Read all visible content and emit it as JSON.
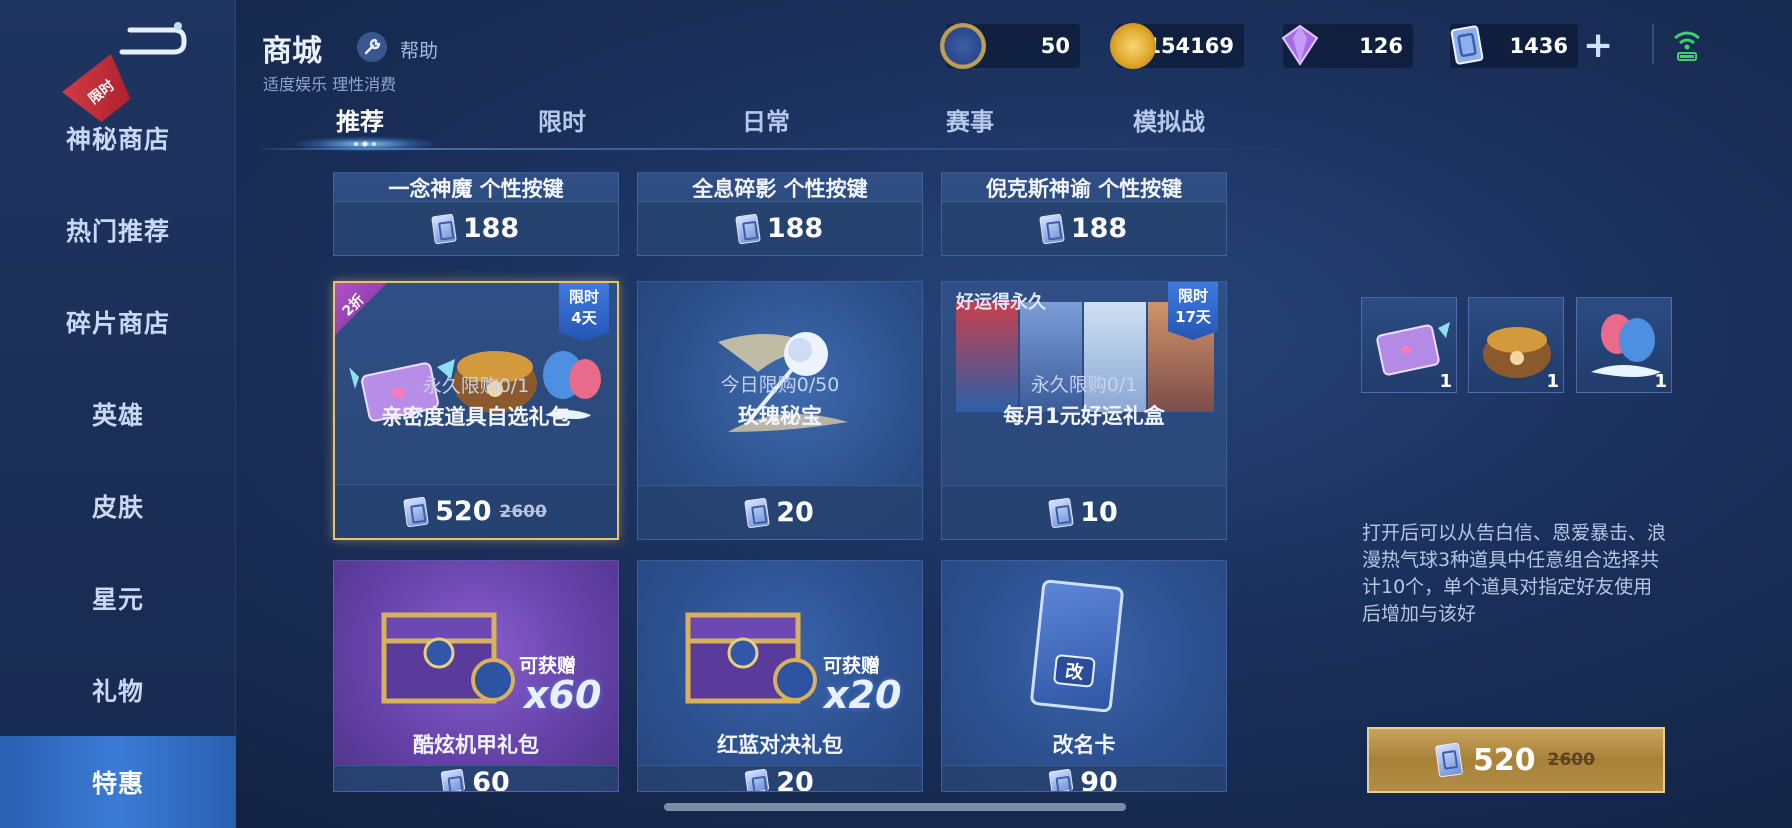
{
  "header": {
    "title": "商城",
    "help_label": "帮助",
    "subtitle": "适度娱乐 理性消费"
  },
  "currencies": [
    {
      "name": "ticket",
      "icon": "ticket-coin-icon",
      "value": "50"
    },
    {
      "name": "gold",
      "icon": "gold-coin-icon",
      "value": "154169"
    },
    {
      "name": "diamond",
      "icon": "diamond-icon",
      "value": "126"
    },
    {
      "name": "coupon",
      "icon": "coupon-icon",
      "value": "1436"
    }
  ],
  "sidebar": {
    "items": [
      {
        "label": "神秘商店",
        "badge": "限时"
      },
      {
        "label": "热门推荐"
      },
      {
        "label": "碎片商店"
      },
      {
        "label": "英雄"
      },
      {
        "label": "皮肤"
      },
      {
        "label": "星元"
      },
      {
        "label": "礼物"
      },
      {
        "label": "特惠",
        "active": true
      }
    ]
  },
  "tabs": [
    "推荐",
    "限时",
    "日常",
    "赛事",
    "模拟战"
  ],
  "active_tab": "推荐",
  "cards": [
    {
      "name": "一念神魔 个性按键",
      "price": "188"
    },
    {
      "name": "全息碎影 个性按键",
      "price": "188"
    },
    {
      "name": "倪克斯神谕 个性按键",
      "price": "188"
    },
    {
      "name": "亲密度道具自选礼包",
      "limit": "永久限购0/1",
      "price": "520",
      "old_price": "2600",
      "discount": "2折",
      "tag_line1": "限时",
      "tag_line2": "4天"
    },
    {
      "name": "玫瑰秘宝",
      "limit": "今日限购0/50",
      "price": "20"
    },
    {
      "name": "每月1元好运礼盒",
      "limit": "永久限购0/1",
      "price": "10",
      "overlay": "好运得永久",
      "tag_line1": "限时",
      "tag_line2": "17天"
    },
    {
      "name": "酷炫机甲礼包",
      "price": "60",
      "gift_note": "可获赠",
      "gift_times": "x60"
    },
    {
      "name": "红蓝对决礼包",
      "price": "20",
      "gift_note": "可获赠",
      "gift_times": "x20"
    },
    {
      "name": "改名卡",
      "price": "90",
      "card_glyph": "改"
    }
  ],
  "detail": {
    "item_counts": [
      "1",
      "1",
      "1"
    ],
    "description": "打开后可以从告白信、恩爱暴击、浪漫热气球3种道具中任意组合选择共计10个，单个道具对指定好友使用后增加与该好",
    "buy_price": "520",
    "buy_old_price": "2600"
  },
  "colors": {
    "accent_gold": "#e7c46a",
    "sidebar_active": "#3b7bd6",
    "limit_red": "#d23a44",
    "tag_blue": "#2f66c8"
  }
}
